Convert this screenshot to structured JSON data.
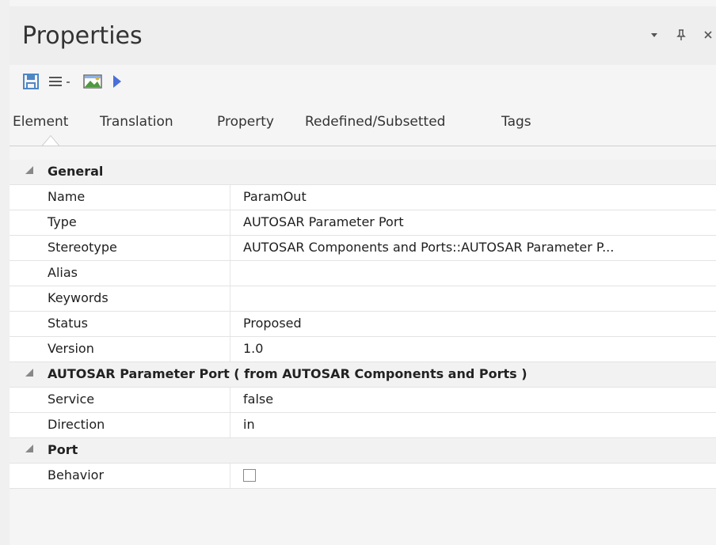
{
  "panel": {
    "title": "Properties",
    "controls": {
      "dropdown_icon": "chevron-down-icon",
      "pin_icon": "pin-icon",
      "close_icon": "close-icon"
    }
  },
  "toolbar": {
    "items": [
      {
        "name": "save-button",
        "icon": "save-icon"
      },
      {
        "name": "menu-button",
        "icon": "hamburger-menu-icon"
      },
      {
        "name": "picture-button",
        "icon": "image-icon"
      },
      {
        "name": "play-button",
        "icon": "play-icon"
      }
    ]
  },
  "tabs": [
    "Element",
    "Translation",
    "Property",
    "Redefined/Subsetted",
    "Tags"
  ],
  "sections": {
    "general": {
      "label": "General",
      "rows": [
        {
          "key": "Name",
          "value": "ParamOut"
        },
        {
          "key": "Type",
          "value": "AUTOSAR Parameter Port"
        },
        {
          "key": "Stereotype",
          "value": "AUTOSAR Components and Ports::AUTOSAR Parameter P..."
        },
        {
          "key": "Alias",
          "value": ""
        },
        {
          "key": "Keywords",
          "value": ""
        },
        {
          "key": "Status",
          "value": "Proposed"
        },
        {
          "key": "Version",
          "value": "1.0"
        }
      ]
    },
    "autosar": {
      "label": "AUTOSAR Parameter Port  ( from AUTOSAR Components and Ports )",
      "rows": [
        {
          "key": "Service",
          "value": "false"
        },
        {
          "key": "Direction",
          "value": "in"
        }
      ]
    },
    "port": {
      "label": "Port",
      "rows": [
        {
          "key": "Behavior",
          "value": ""
        }
      ]
    }
  },
  "colors": {
    "accent_blue": "#4a6fd8",
    "save_icon": "#4f86c6"
  }
}
